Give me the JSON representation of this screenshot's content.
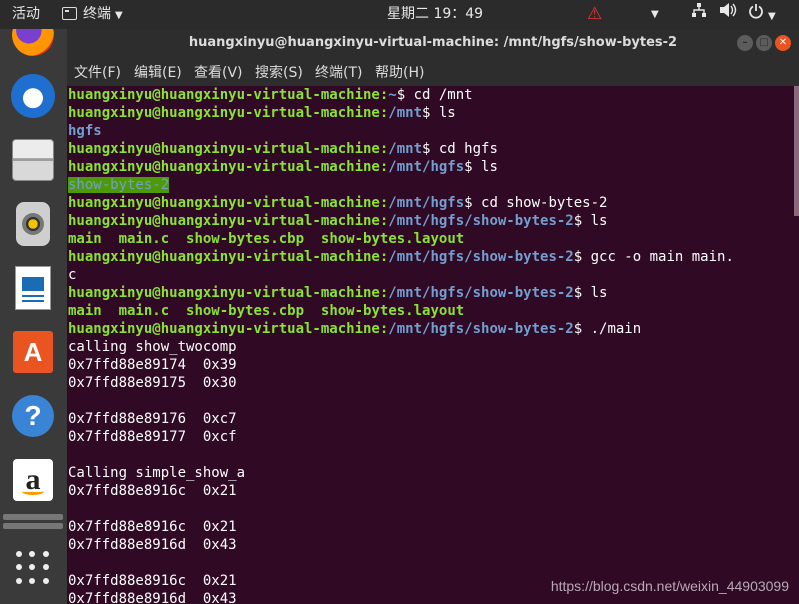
{
  "topbar": {
    "activities": "活动",
    "app_menu": "终端",
    "clock": "星期二 19：49",
    "warning_icon": "⚠",
    "dropdown_icon": "▼",
    "network_icon": "network-icon",
    "volume_icon": "volume-icon",
    "power_icon": "power-icon"
  },
  "window": {
    "title": "huangxinyu@huangxinyu-virtual-machine: /mnt/hgfs/show-bytes-2"
  },
  "menubar": {
    "file": "文件(F)",
    "edit": "编辑(E)",
    "view": "查看(V)",
    "search": "搜索(S)",
    "terminal": "终端(T)",
    "help": "帮助(H)"
  },
  "terminal": {
    "user_host": "huangxinyu@huangxinyu-virtual-machine",
    "lines": [
      {
        "path": "~",
        "cmd": "$ cd /mnt"
      },
      {
        "path": "/mnt",
        "cmd": "$ ls"
      },
      {
        "out": "hgfs"
      },
      {
        "path": "/mnt",
        "cmd": "$ cd hgfs"
      },
      {
        "path": "/mnt/hgfs",
        "cmd": "$ ls"
      },
      {
        "out": "show-bytes-2"
      },
      {
        "path": "/mnt/hgfs",
        "cmd": "$ cd show-bytes-2"
      },
      {
        "path": "/mnt/hgfs/show-bytes-2",
        "cmd": "$ ls"
      },
      {
        "files": [
          "main",
          "main.c",
          "show-bytes.cbp",
          "show-bytes.layout"
        ]
      },
      {
        "path": "/mnt/hgfs/show-bytes-2",
        "cmd": "$ gcc -o main main."
      },
      {
        "out": "c"
      },
      {
        "path": "/mnt/hgfs/show-bytes-2",
        "cmd": "$ ls"
      },
      {
        "files": [
          "main",
          "main.c",
          "show-bytes.cbp",
          "show-bytes.layout"
        ]
      },
      {
        "path": "/mnt/hgfs/show-bytes-2",
        "cmd": "$ ./main"
      },
      {
        "out": "calling show_twocomp"
      },
      {
        "out": "0x7ffd88e89174  0x39"
      },
      {
        "out": "0x7ffd88e89175  0x30"
      },
      {
        "out": ""
      },
      {
        "out": "0x7ffd88e89176  0xc7"
      },
      {
        "out": "0x7ffd88e89177  0xcf"
      },
      {
        "out": ""
      },
      {
        "out": "Calling simple_show_a"
      },
      {
        "out": "0x7ffd88e8916c  0x21"
      },
      {
        "out": ""
      },
      {
        "out": "0x7ffd88e8916c  0x21"
      },
      {
        "out": "0x7ffd88e8916d  0x43"
      },
      {
        "out": ""
      },
      {
        "out": "0x7ffd88e8916c  0x21"
      },
      {
        "out": "0x7ffd88e8916d  0x43"
      }
    ]
  },
  "watermark": "https://blog.csdn.net/weixin_44903099"
}
